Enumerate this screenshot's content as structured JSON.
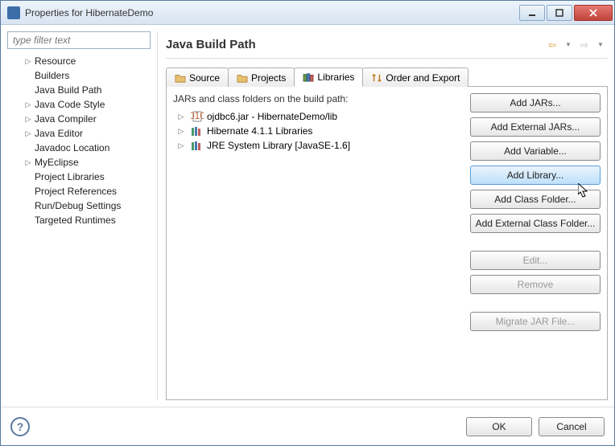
{
  "window": {
    "title": "Properties for HibernateDemo"
  },
  "filter": {
    "placeholder": "type filter text"
  },
  "sidebar": {
    "items": [
      {
        "label": "Resource",
        "expandable": true
      },
      {
        "label": "Builders"
      },
      {
        "label": "Java Build Path",
        "selected": true
      },
      {
        "label": "Java Code Style",
        "expandable": true
      },
      {
        "label": "Java Compiler",
        "expandable": true
      },
      {
        "label": "Java Editor",
        "expandable": true
      },
      {
        "label": "Javadoc Location"
      },
      {
        "label": "MyEclipse",
        "expandable": true
      },
      {
        "label": "Project Libraries"
      },
      {
        "label": "Project References"
      },
      {
        "label": "Run/Debug Settings"
      },
      {
        "label": "Targeted Runtimes"
      }
    ]
  },
  "header": {
    "title": "Java Build Path"
  },
  "tabs": [
    {
      "label": "Source"
    },
    {
      "label": "Projects"
    },
    {
      "label": "Libraries",
      "active": true
    },
    {
      "label": "Order and Export"
    }
  ],
  "libraries": {
    "caption": "JARs and class folders on the build path:",
    "items": [
      {
        "label": "ojdbc6.jar - HibernateDemo/lib",
        "icon": "jar"
      },
      {
        "label": "Hibernate 4.1.1 Libraries",
        "icon": "lib"
      },
      {
        "label": "JRE System Library [JavaSE-1.6]",
        "icon": "lib"
      }
    ]
  },
  "buttons": {
    "add_jars": "Add JARs...",
    "add_ext_jars": "Add External JARs...",
    "add_variable": "Add Variable...",
    "add_library": "Add Library...",
    "add_class_folder": "Add Class Folder...",
    "add_ext_class_folder": "Add External Class Folder...",
    "edit": "Edit...",
    "remove": "Remove",
    "migrate": "Migrate JAR File..."
  },
  "footer": {
    "ok": "OK",
    "cancel": "Cancel"
  }
}
